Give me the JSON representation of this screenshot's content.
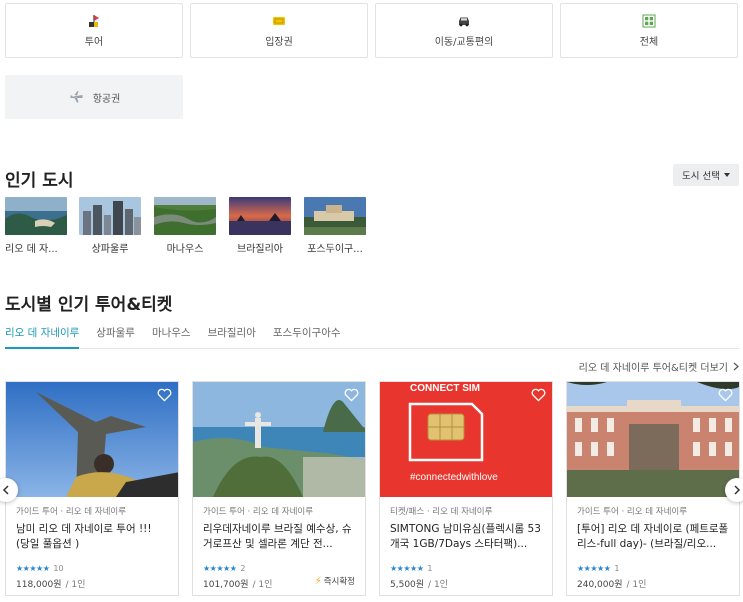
{
  "categories": [
    {
      "label": "투어",
      "icon": "tour-icon"
    },
    {
      "label": "입장권",
      "icon": "ticket-icon"
    },
    {
      "label": "이동/교통편의",
      "icon": "car-icon"
    },
    {
      "label": "전체",
      "icon": "grid-icon"
    },
    {
      "label": "항공권",
      "icon": "airplane-icon"
    }
  ],
  "popular_cities": {
    "title": "인기 도시",
    "select_label": "도시 선택",
    "cities": [
      "리오 데 자...",
      "상파울루",
      "마나우스",
      "브라질리아",
      "포스두이구..."
    ]
  },
  "tours_by_city": {
    "title": "도시별 인기 투어&티켓",
    "tabs": [
      "리오 데 자네이루",
      "상파울루",
      "마나우스",
      "브라질리아",
      "포스두이구아수"
    ],
    "active_tab": 0,
    "more_link": "리오 데 자네이루 투어&티켓 더보기",
    "cards": [
      {
        "category": "가이드 투어 · 리오 데 자네이루",
        "title": "남미 리오 데 자네이로 투어 !!! (당일 풀옵션 )",
        "rating": "★★★★★",
        "review_count": "10",
        "price": "118,000원",
        "per": "/ 1인",
        "instant": ""
      },
      {
        "category": "가이드 투어 · 리오 데 자네이루",
        "title": "리우데자네이루 브라질 예수상, 슈거로프산 및 셀라론 계단 전...",
        "rating": "★★★★★",
        "review_count": "2",
        "price": "101,700원",
        "per": "/ 1인",
        "instant": "즉시확정"
      },
      {
        "category": "티켓/패스 · 리오 데 자네이루",
        "title": "SIMTONG 남미유심(플렉시롬 53개국 1GB/7Days 스타터팩)...",
        "rating": "★★★★★",
        "review_count": "1",
        "price": "5,500원",
        "per": "/ 1인",
        "instant": ""
      },
      {
        "category": "가이드 투어 · 리오 데 자네이루",
        "title": "[투어] 리오 데 자네이로 (페트로폴리스-full day)- (브라질/리오...",
        "rating": "★★★★★",
        "review_count": "1",
        "price": "240,000원",
        "per": "/ 1인",
        "instant": ""
      }
    ],
    "sim_banner_text": "CONNECT SIM",
    "sim_hashtag": "#connectedwithlove"
  },
  "colors": {
    "accent": "#1a9ab8",
    "star": "#2a86d0",
    "bolt": "#f5a623",
    "sim_red": "#e8352e"
  }
}
